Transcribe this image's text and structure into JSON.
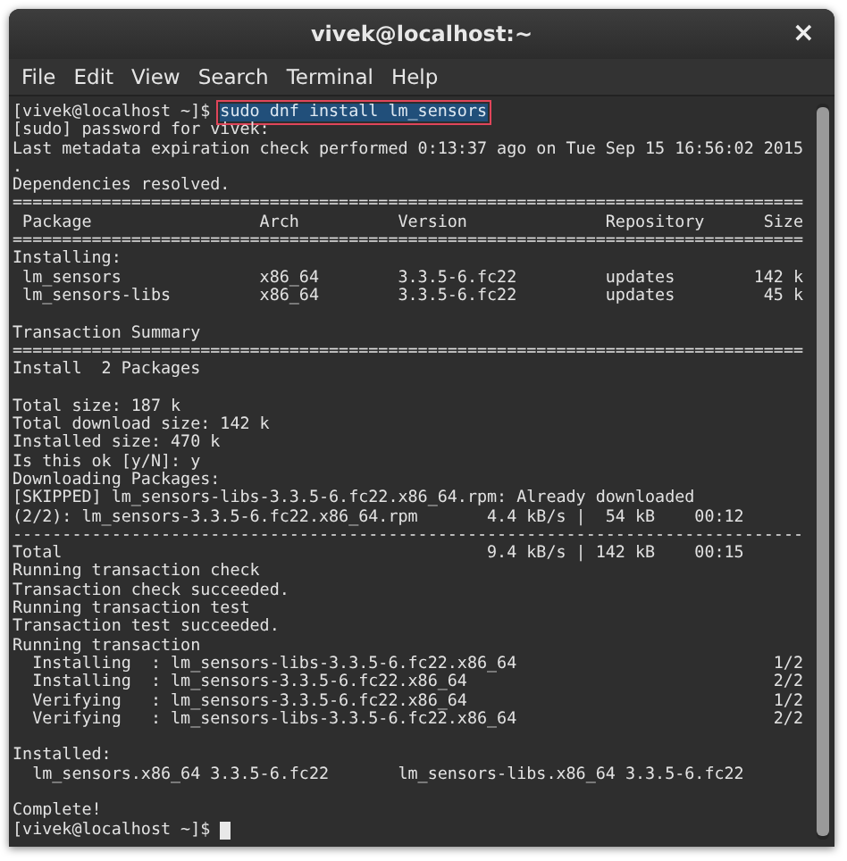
{
  "window": {
    "title": "vivek@localhost:~",
    "close": "×"
  },
  "menu": [
    "File",
    "Edit",
    "View",
    "Search",
    "Terminal",
    "Help"
  ],
  "terminal": {
    "lines": [
      {
        "kind": "prompt",
        "prompt": "[vivek@localhost ~]$",
        "command": "sudo dnf install lm_sensors",
        "highlighted": true
      },
      {
        "kind": "text",
        "text": "[sudo] password for vivek:"
      },
      {
        "kind": "text",
        "text": "Last metadata expiration check performed 0:13:37 ago on Tue Sep 15 16:56:02 2015"
      },
      {
        "kind": "text",
        "text": "."
      },
      {
        "kind": "text",
        "text": "Dependencies resolved."
      },
      {
        "kind": "text",
        "text": "================================================================================"
      },
      {
        "kind": "table-header",
        "cells": [
          "Package",
          "Arch",
          "Version",
          "Repository",
          "Size"
        ]
      },
      {
        "kind": "text",
        "text": "================================================================================"
      },
      {
        "kind": "text",
        "text": "Installing:"
      },
      {
        "kind": "table-row",
        "cells": [
          "lm_sensors",
          "x86_64",
          "3.3.5-6.fc22",
          "updates",
          "142 k"
        ]
      },
      {
        "kind": "table-row",
        "cells": [
          "lm_sensors-libs",
          "x86_64",
          "3.3.5-6.fc22",
          "updates",
          "45 k"
        ]
      },
      {
        "kind": "blank"
      },
      {
        "kind": "text",
        "text": "Transaction Summary"
      },
      {
        "kind": "text",
        "text": "================================================================================"
      },
      {
        "kind": "text",
        "text": "Install  2 Packages"
      },
      {
        "kind": "blank"
      },
      {
        "kind": "text",
        "text": "Total size: 187 k"
      },
      {
        "kind": "text",
        "text": "Total download size: 142 k"
      },
      {
        "kind": "text",
        "text": "Installed size: 470 k"
      },
      {
        "kind": "text",
        "text": "Is this ok [y/N]: y"
      },
      {
        "kind": "text",
        "text": "Downloading Packages:"
      },
      {
        "kind": "text",
        "text": "[SKIPPED] lm_sensors-libs-3.3.5-6.fc22.x86_64.rpm: Already downloaded"
      },
      {
        "kind": "transfer",
        "file": "(2/2): lm_sensors-3.3.5-6.fc22.x86_64.rpm",
        "stats": "4.4 kB/s |  54 kB    00:12"
      },
      {
        "kind": "text",
        "text": "--------------------------------------------------------------------------------"
      },
      {
        "kind": "transfer",
        "file": "Total",
        "stats": "9.4 kB/s | 142 kB    00:15"
      },
      {
        "kind": "text",
        "text": "Running transaction check"
      },
      {
        "kind": "text",
        "text": "Transaction check succeeded."
      },
      {
        "kind": "text",
        "text": "Running transaction test"
      },
      {
        "kind": "text",
        "text": "Transaction test succeeded."
      },
      {
        "kind": "text",
        "text": "Running transaction"
      },
      {
        "kind": "step",
        "action": "Installing  : lm_sensors-libs-3.3.5-6.fc22.x86_64",
        "count": "1/2"
      },
      {
        "kind": "step",
        "action": "Installing  : lm_sensors-3.3.5-6.fc22.x86_64",
        "count": "2/2"
      },
      {
        "kind": "step",
        "action": "Verifying   : lm_sensors-3.3.5-6.fc22.x86_64",
        "count": "1/2"
      },
      {
        "kind": "step",
        "action": "Verifying   : lm_sensors-libs-3.3.5-6.fc22.x86_64",
        "count": "2/2"
      },
      {
        "kind": "blank"
      },
      {
        "kind": "text",
        "text": "Installed:"
      },
      {
        "kind": "installed",
        "items": [
          "lm_sensors.x86_64 3.3.5-6.fc22",
          "lm_sensors-libs.x86_64 3.3.5-6.fc22"
        ]
      },
      {
        "kind": "blank"
      },
      {
        "kind": "text",
        "text": "Complete!"
      },
      {
        "kind": "prompt",
        "prompt": "[vivek@localhost ~]$",
        "cursor": true
      }
    ]
  }
}
